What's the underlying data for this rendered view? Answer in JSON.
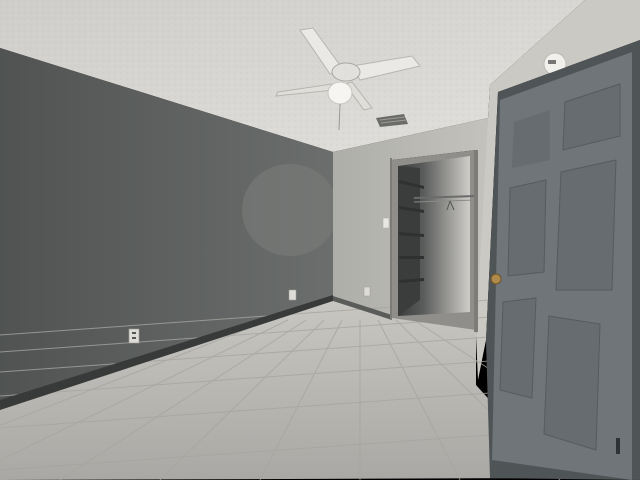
{
  "scene": {
    "description_tags": [
      "empty-bedroom",
      "ceiling-fan",
      "open-closet",
      "tile-floor",
      "paneled-door",
      "thermostat"
    ],
    "colors": {
      "ceiling": "#d9d7d3",
      "left_wall": "#606362",
      "back_wall": "#b9b8b3",
      "right_wall": "#c9c7c2",
      "floor": "#bdbcb7",
      "grout": "#a9a8a3",
      "baseboard": "#3c3e3d",
      "door": "#6d7376",
      "door_trim": "#5f6466",
      "closet_interior": "#4a4c4c",
      "fan": "#e8e6e2"
    },
    "icons": {
      "outlet": "electrical-outlet-icon",
      "thermostat": "thermostat-icon",
      "vent": "air-vent-icon",
      "doorknob": "doorknob-icon",
      "fan": "ceiling-fan-icon"
    }
  }
}
